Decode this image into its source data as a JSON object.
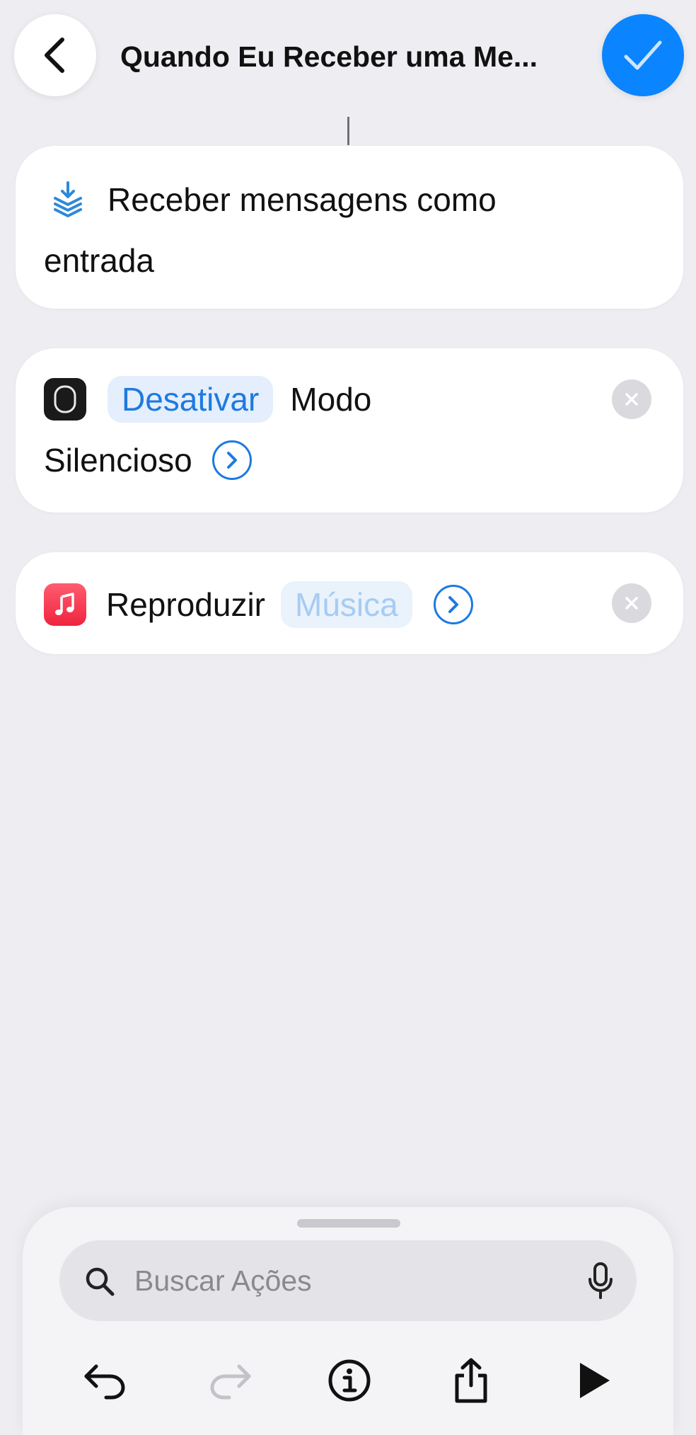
{
  "header": {
    "title": "Quando Eu Receber uma Me...",
    "back_icon": "chevron-left-icon",
    "done_icon": "checkmark-icon",
    "accent_color": "#0a84ff"
  },
  "actions": [
    {
      "icon": "receive-input-icon",
      "line1": "Receber mensagens como",
      "line2": "entrada"
    },
    {
      "icon": "focus-mode-icon",
      "token": "Desativar",
      "line1_rest": "Modo",
      "line2": "Silencioso",
      "show_more_icon": "chevron-right-circle-icon",
      "remove_icon": "remove-icon"
    },
    {
      "icon": "music-app-icon",
      "verb": "Reproduzir",
      "token": "Música",
      "show_more_icon": "chevron-right-circle-icon",
      "remove_icon": "remove-icon"
    }
  ],
  "bottom_sheet": {
    "search_placeholder": "Buscar Ações",
    "search_icon": "magnifier-icon",
    "mic_icon": "microphone-icon",
    "toolbar": [
      "undo-icon",
      "redo-icon",
      "info-icon",
      "share-icon",
      "play-icon"
    ]
  }
}
